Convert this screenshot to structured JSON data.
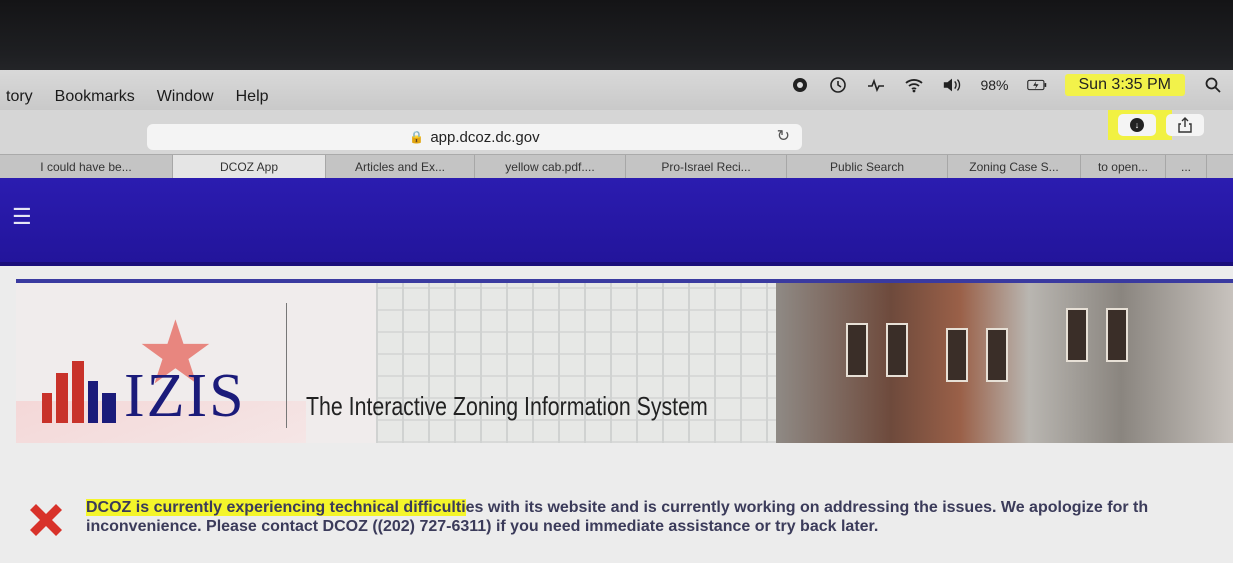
{
  "menubar": {
    "items": [
      "tory",
      "Bookmarks",
      "Window",
      "Help"
    ],
    "battery": "98%",
    "clock": "Sun 3:35 PM"
  },
  "toolbar": {
    "url": "app.dcoz.dc.gov"
  },
  "tabs": [
    {
      "label": "I could have be..."
    },
    {
      "label": "DCOZ App"
    },
    {
      "label": "Articles and Ex..."
    },
    {
      "label": "yellow cab.pdf...."
    },
    {
      "label": "Pro-Israel Reci..."
    },
    {
      "label": "Public Search"
    },
    {
      "label": "Zoning Case S..."
    },
    {
      "label": "to open..."
    },
    {
      "label": "..."
    }
  ],
  "banner": {
    "logo_text": "IZIS",
    "tagline": "The Interactive Zoning Information System"
  },
  "alert": {
    "highlighted": "DCOZ is currently experiencing technical difficulti",
    "line1_rest": "es with its website and is currently working on addressing the issues. We apologize for th",
    "line2": "inconvenience. Please contact DCOZ ((202) 727-6311)  if you need immediate assistance or try back later."
  },
  "colors": {
    "header_blue": "#2b1cb0",
    "highlight_yellow": "#f4f52a",
    "logo_blue": "#1b1b7a",
    "logo_pink": "#e8867f"
  }
}
